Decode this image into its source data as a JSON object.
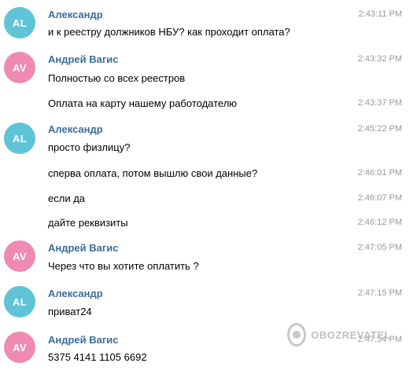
{
  "messages": [
    {
      "avatar": "AL",
      "avatar_color": "#5fc4d6",
      "sender": "Александр",
      "text": "и к реестру должников НБУ? как проходит оплата?",
      "time": "2:43:11 PM"
    },
    {
      "avatar": "AV",
      "avatar_color": "#ef8ab0",
      "sender": "Андрей Вагис",
      "text": "Полностью со всех реестров",
      "time": "2:43:32 PM"
    },
    {
      "text": "Оплата на карту нашему работодателю",
      "time": "2:43:37 PM"
    },
    {
      "avatar": "AL",
      "avatar_color": "#5fc4d6",
      "sender": "Александр",
      "text": "просто физлицу?",
      "time": "2:45:22 PM"
    },
    {
      "text": "сперва оплата, потом вышлю свои данные?",
      "time": "2:46:01 PM"
    },
    {
      "text": "если да",
      "time": "2:46:07 PM"
    },
    {
      "text": "дайте реквизиты",
      "time": "2:46:12 PM"
    },
    {
      "avatar": "AV",
      "avatar_color": "#ef8ab0",
      "sender": "Андрей Вагис",
      "text": "Через что вы хотите оплатить ?",
      "time": "2:47:05 PM"
    },
    {
      "avatar": "AL",
      "avatar_color": "#5fc4d6",
      "sender": "Александр",
      "text": "приват24",
      "time": "2:47:15 PM"
    },
    {
      "avatar": "AV",
      "avatar_color": "#ef8ab0",
      "sender": "Андрей Вагис",
      "text": "5375 4141 1105 6692",
      "time": "2:47:54 PM"
    }
  ],
  "watermark": {
    "text": "OBOZREVATEL",
    "logo_icon": "obozrevatel-logo-icon"
  }
}
